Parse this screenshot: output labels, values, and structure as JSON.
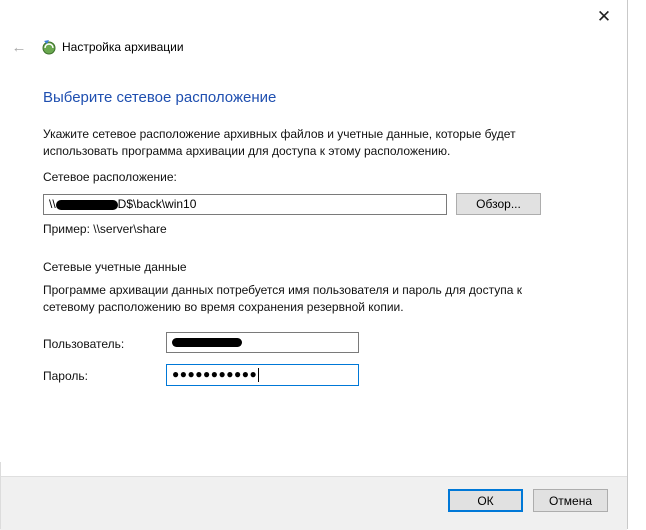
{
  "window": {
    "title": "Настройка архивации",
    "close_glyph": "✕",
    "back_glyph": "←"
  },
  "heading": "Выберите сетевое расположение",
  "description": "Укажите сетевое расположение архивных файлов и учетные данные, которые будет использовать программа архивации для доступа к этому расположению.",
  "network_location": {
    "label": "Сетевое расположение:",
    "value_prefix": "\\\\",
    "value_suffix": "D$\\back\\win10",
    "browse_label": "Обзор...",
    "example": "Пример: \\\\server\\share"
  },
  "credentials": {
    "section_label": "Сетевые учетные данные",
    "description": "Программе архивации данных потребуется имя пользователя и пароль для доступа к сетевому расположению во время сохранения резервной копии.",
    "user_label": "Пользователь:",
    "password_label": "Пароль:",
    "password_mask": "●●●●●●●●●●●"
  },
  "footer": {
    "ok_label": "ОК",
    "cancel_label": "Отмена"
  },
  "colors": {
    "heading": "#1f4fb0",
    "focus_border": "#0078d7",
    "footer_bg": "#f0f0f0"
  },
  "icons": [
    "back-arrow-icon",
    "backup-icon",
    "close-icon"
  ]
}
